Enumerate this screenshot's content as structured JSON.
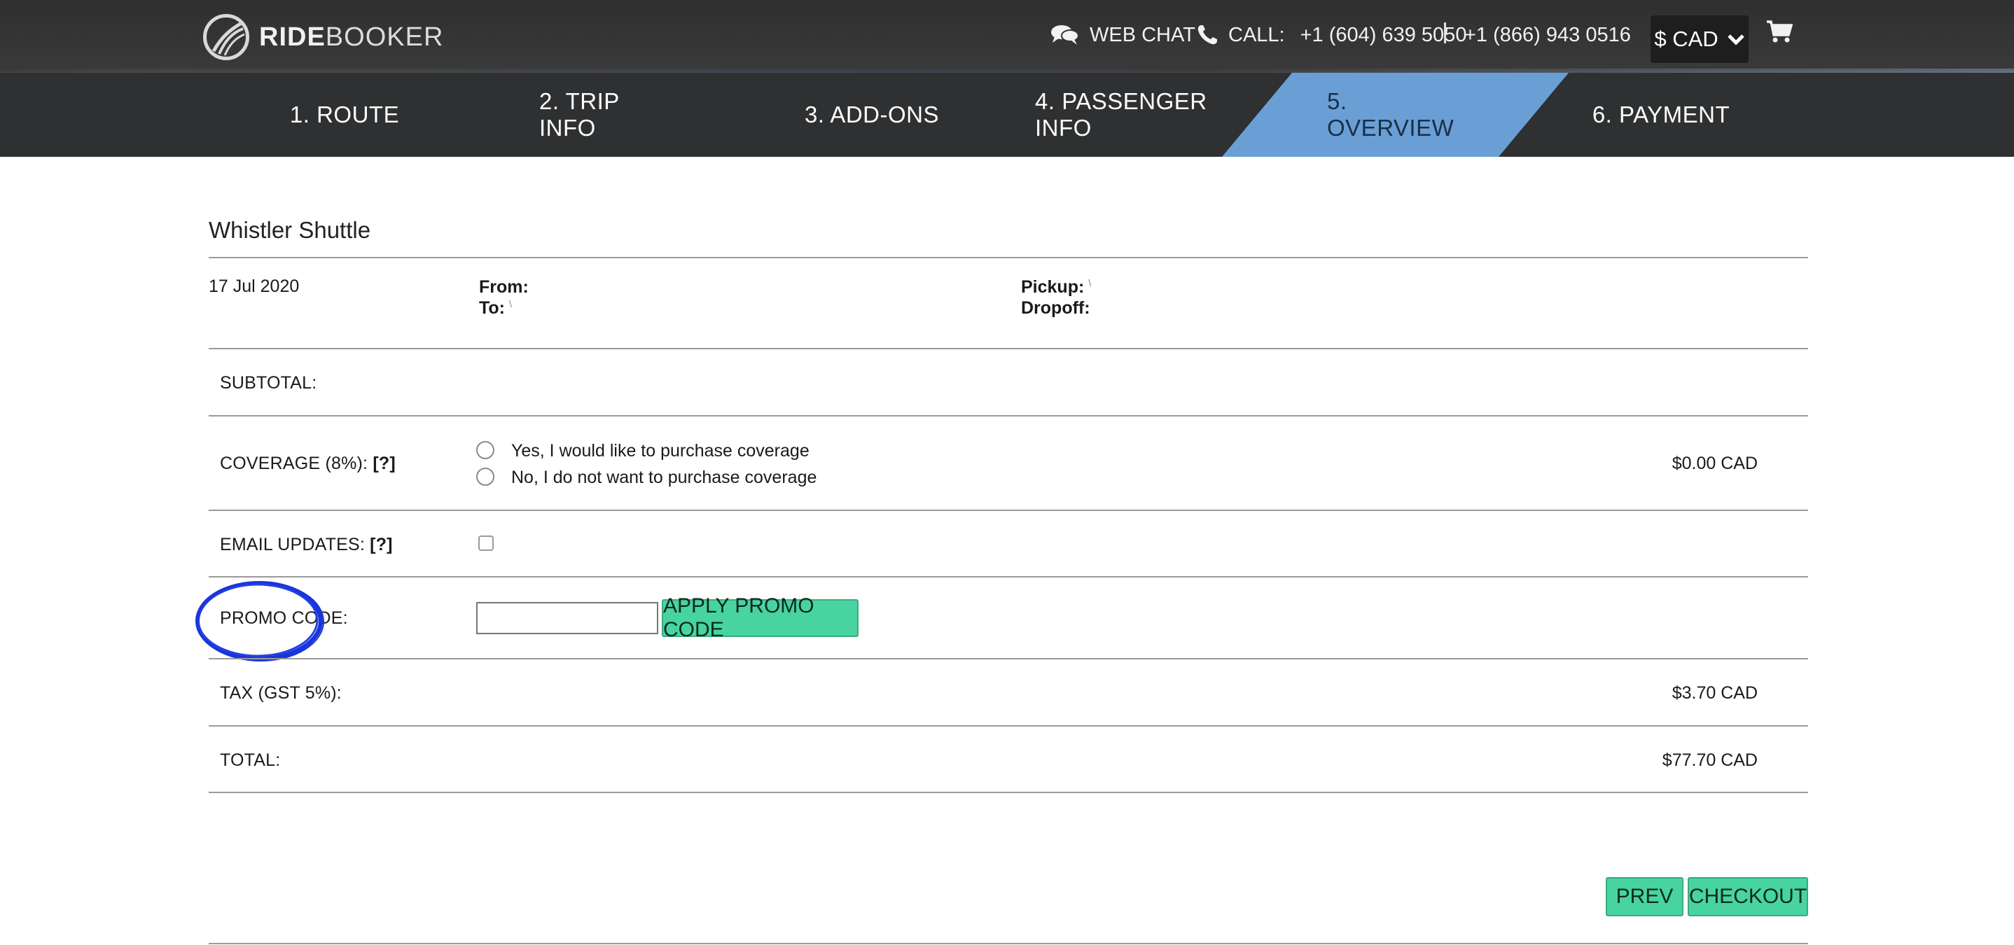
{
  "header": {
    "logo_bold": "RIDE",
    "logo_light": "BOOKER",
    "webchat_label": "WEB CHAT",
    "call_label": "CALL:",
    "phone1": "+1 (604) 639 5050",
    "phone2": "+1 (866) 943 0516",
    "currency_label": "$ CAD",
    "icons": {
      "logo": "ridebooker-logo-icon",
      "chat": "chat-bubbles-icon",
      "phone": "phone-icon",
      "dropdown": "chevron-down-icon",
      "cart": "shopping-cart-icon"
    }
  },
  "steps": [
    {
      "label": "1. ROUTE"
    },
    {
      "label": "2. TRIP INFO"
    },
    {
      "label": "3. ADD-ONS"
    },
    {
      "label": "4. PASSENGER INFO"
    },
    {
      "label": "5. OVERVIEW",
      "active": true
    },
    {
      "label": "6. PAYMENT"
    }
  ],
  "trip": {
    "title": "Whistler Shuttle",
    "date": "17 Jul 2020",
    "from_label": "From:",
    "to_label": "To:",
    "to_value": "\\",
    "pickup_label": "Pickup:",
    "pickup_value": "\\",
    "dropoff_label": "Dropoff:"
  },
  "summary": {
    "subtotal_label": "SUBTOTAL:",
    "coverage_label": "COVERAGE (8%):",
    "help_mark": "[?]",
    "coverage_yes": "Yes, I would like to purchase coverage",
    "coverage_no": "No, I do not want to purchase coverage",
    "coverage_amount": "$0.00 CAD",
    "email_label": "EMAIL UPDATES:",
    "promo_label": "PROMO CODE:",
    "promo_value": "",
    "apply_label": "APPLY PROMO CODE",
    "tax_label": "TAX (GST 5%):",
    "tax_amount": "$3.70 CAD",
    "total_label": "TOTAL:",
    "total_amount": "$77.70 CAD"
  },
  "actions": {
    "prev_label": "PREV",
    "checkout_label": "CHECKOUT"
  },
  "colors": {
    "accent_blue": "#6a9fd6",
    "button_green": "#48d4a0",
    "annotation_blue": "#1a35d8"
  }
}
